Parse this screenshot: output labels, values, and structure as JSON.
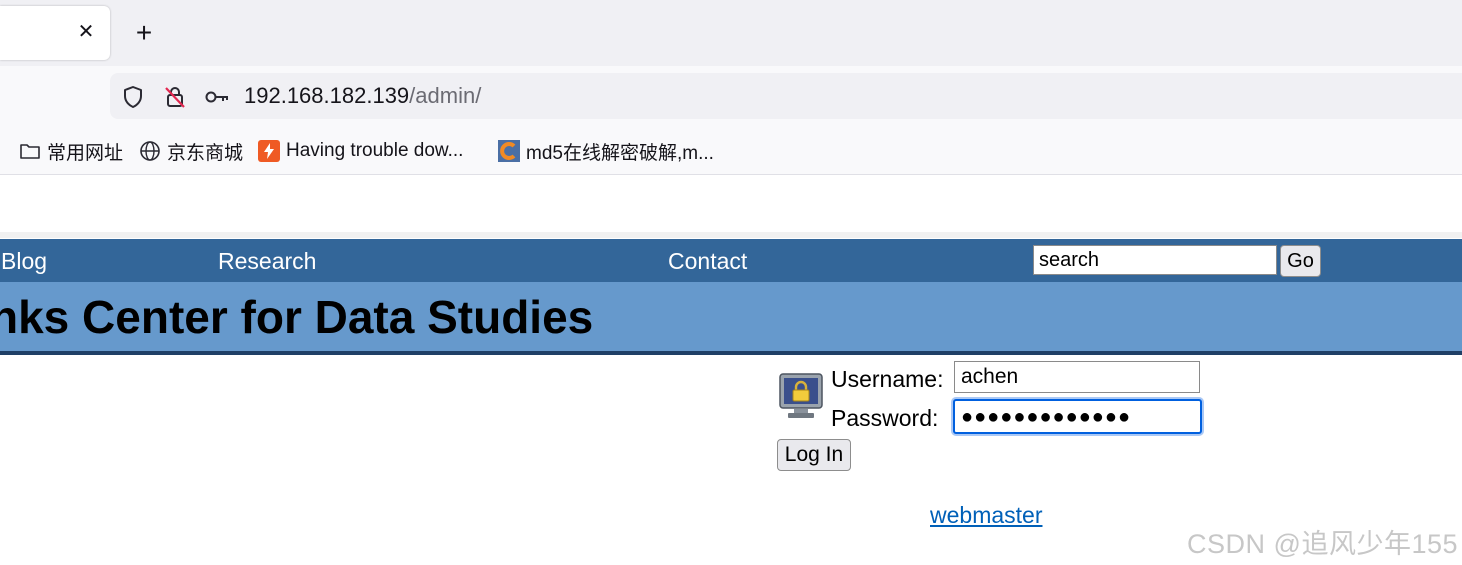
{
  "browser": {
    "tab": {
      "close_glyph": "✕"
    },
    "new_tab_glyph": "+",
    "address": {
      "host": "192.168.182.139",
      "path": "/admin/"
    },
    "bookmarks": [
      {
        "label": "常用网址",
        "icon": "folder-icon"
      },
      {
        "label": "京东商城",
        "icon": "globe-icon"
      },
      {
        "label": "Having trouble dow...",
        "icon": "bolt-favicon"
      },
      {
        "label": "md5在线解密破解,m...",
        "icon": "cmd5-favicon"
      }
    ]
  },
  "site": {
    "nav": {
      "blog": "Blog",
      "research": "Research",
      "contact": "Contact"
    },
    "search": {
      "value": "search",
      "button": "Go"
    },
    "title": "nks Center for Data Studies"
  },
  "login": {
    "username_label": "Username:",
    "username_value": "achen",
    "password_label": "Password:",
    "password_mask": "●●●●●●●●●●●●●",
    "button": "Log In",
    "webmaster_link": "webmaster"
  },
  "watermark": "CSDN @追风少年155",
  "colors": {
    "nav_bg": "#336699",
    "banner_bg": "#6699cc",
    "link": "#0060b8",
    "focus": "#0060df"
  }
}
